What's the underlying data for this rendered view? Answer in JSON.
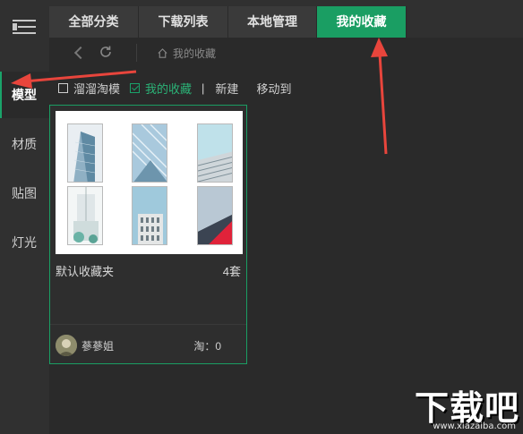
{
  "sidebar": {
    "items": [
      {
        "label": "模型",
        "active": true
      },
      {
        "label": "材质",
        "active": false
      },
      {
        "label": "贴图",
        "active": false
      },
      {
        "label": "灯光",
        "active": false
      }
    ]
  },
  "tabs": [
    {
      "label": "全部分类",
      "active": false
    },
    {
      "label": "下载列表",
      "active": false
    },
    {
      "label": "本地管理",
      "active": false
    },
    {
      "label": "我的收藏",
      "active": true
    }
  ],
  "breadcrumb": {
    "label": "我的收藏"
  },
  "toolbar": {
    "option1": "溜溜淘模",
    "option2": "我的收藏",
    "separator": "|",
    "new_label": "新建",
    "move_label": "移动到"
  },
  "card": {
    "name": "默认收藏夹",
    "count": "4套",
    "user": "蔘蔘姐",
    "tao": "淘：0"
  },
  "watermark": {
    "big": "下载吧",
    "small": "www.xiazaiba.com"
  },
  "colors": {
    "accent": "#1a9e63",
    "arrow": "#e8453c",
    "bg": "#2a2a2a",
    "panel": "#303030"
  }
}
